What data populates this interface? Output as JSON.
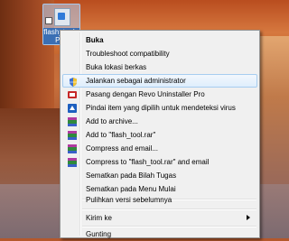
{
  "desktop_icon": {
    "label": "flash_tool - Pint"
  },
  "context_menu": {
    "items": [
      {
        "label": "Buka",
        "icon": "none"
      },
      {
        "label": "Troubleshoot compatibility",
        "icon": "none"
      },
      {
        "label": "Buka lokasi berkas",
        "icon": "none"
      },
      {
        "label": "Jalankan sebagai administrator",
        "icon": "shield-icon"
      },
      {
        "label": "Pasang dengan Revo Uninstaller Pro",
        "icon": "revo-icon"
      },
      {
        "label": "Pindai item yang dipilih untuk mendeteksi virus",
        "icon": "antivirus-icon"
      },
      {
        "label": "Add to archive...",
        "icon": "winrar-icon"
      },
      {
        "label": "Add to \"flash_tool.rar\"",
        "icon": "winrar-icon"
      },
      {
        "label": "Compress and email...",
        "icon": "winrar-icon"
      },
      {
        "label": "Compress to \"flash_tool.rar\" and email",
        "icon": "winrar-icon"
      },
      {
        "label": "Sematkan pada Bilah Tugas",
        "icon": "none"
      },
      {
        "label": "Sematkan pada Menu Mulai",
        "icon": "none"
      },
      {
        "label": "Pulihkan versi sebelumnya",
        "icon": "none"
      },
      {
        "label": "Kirim ke",
        "icon": "none"
      },
      {
        "label": "Gunting",
        "icon": "none"
      }
    ]
  }
}
